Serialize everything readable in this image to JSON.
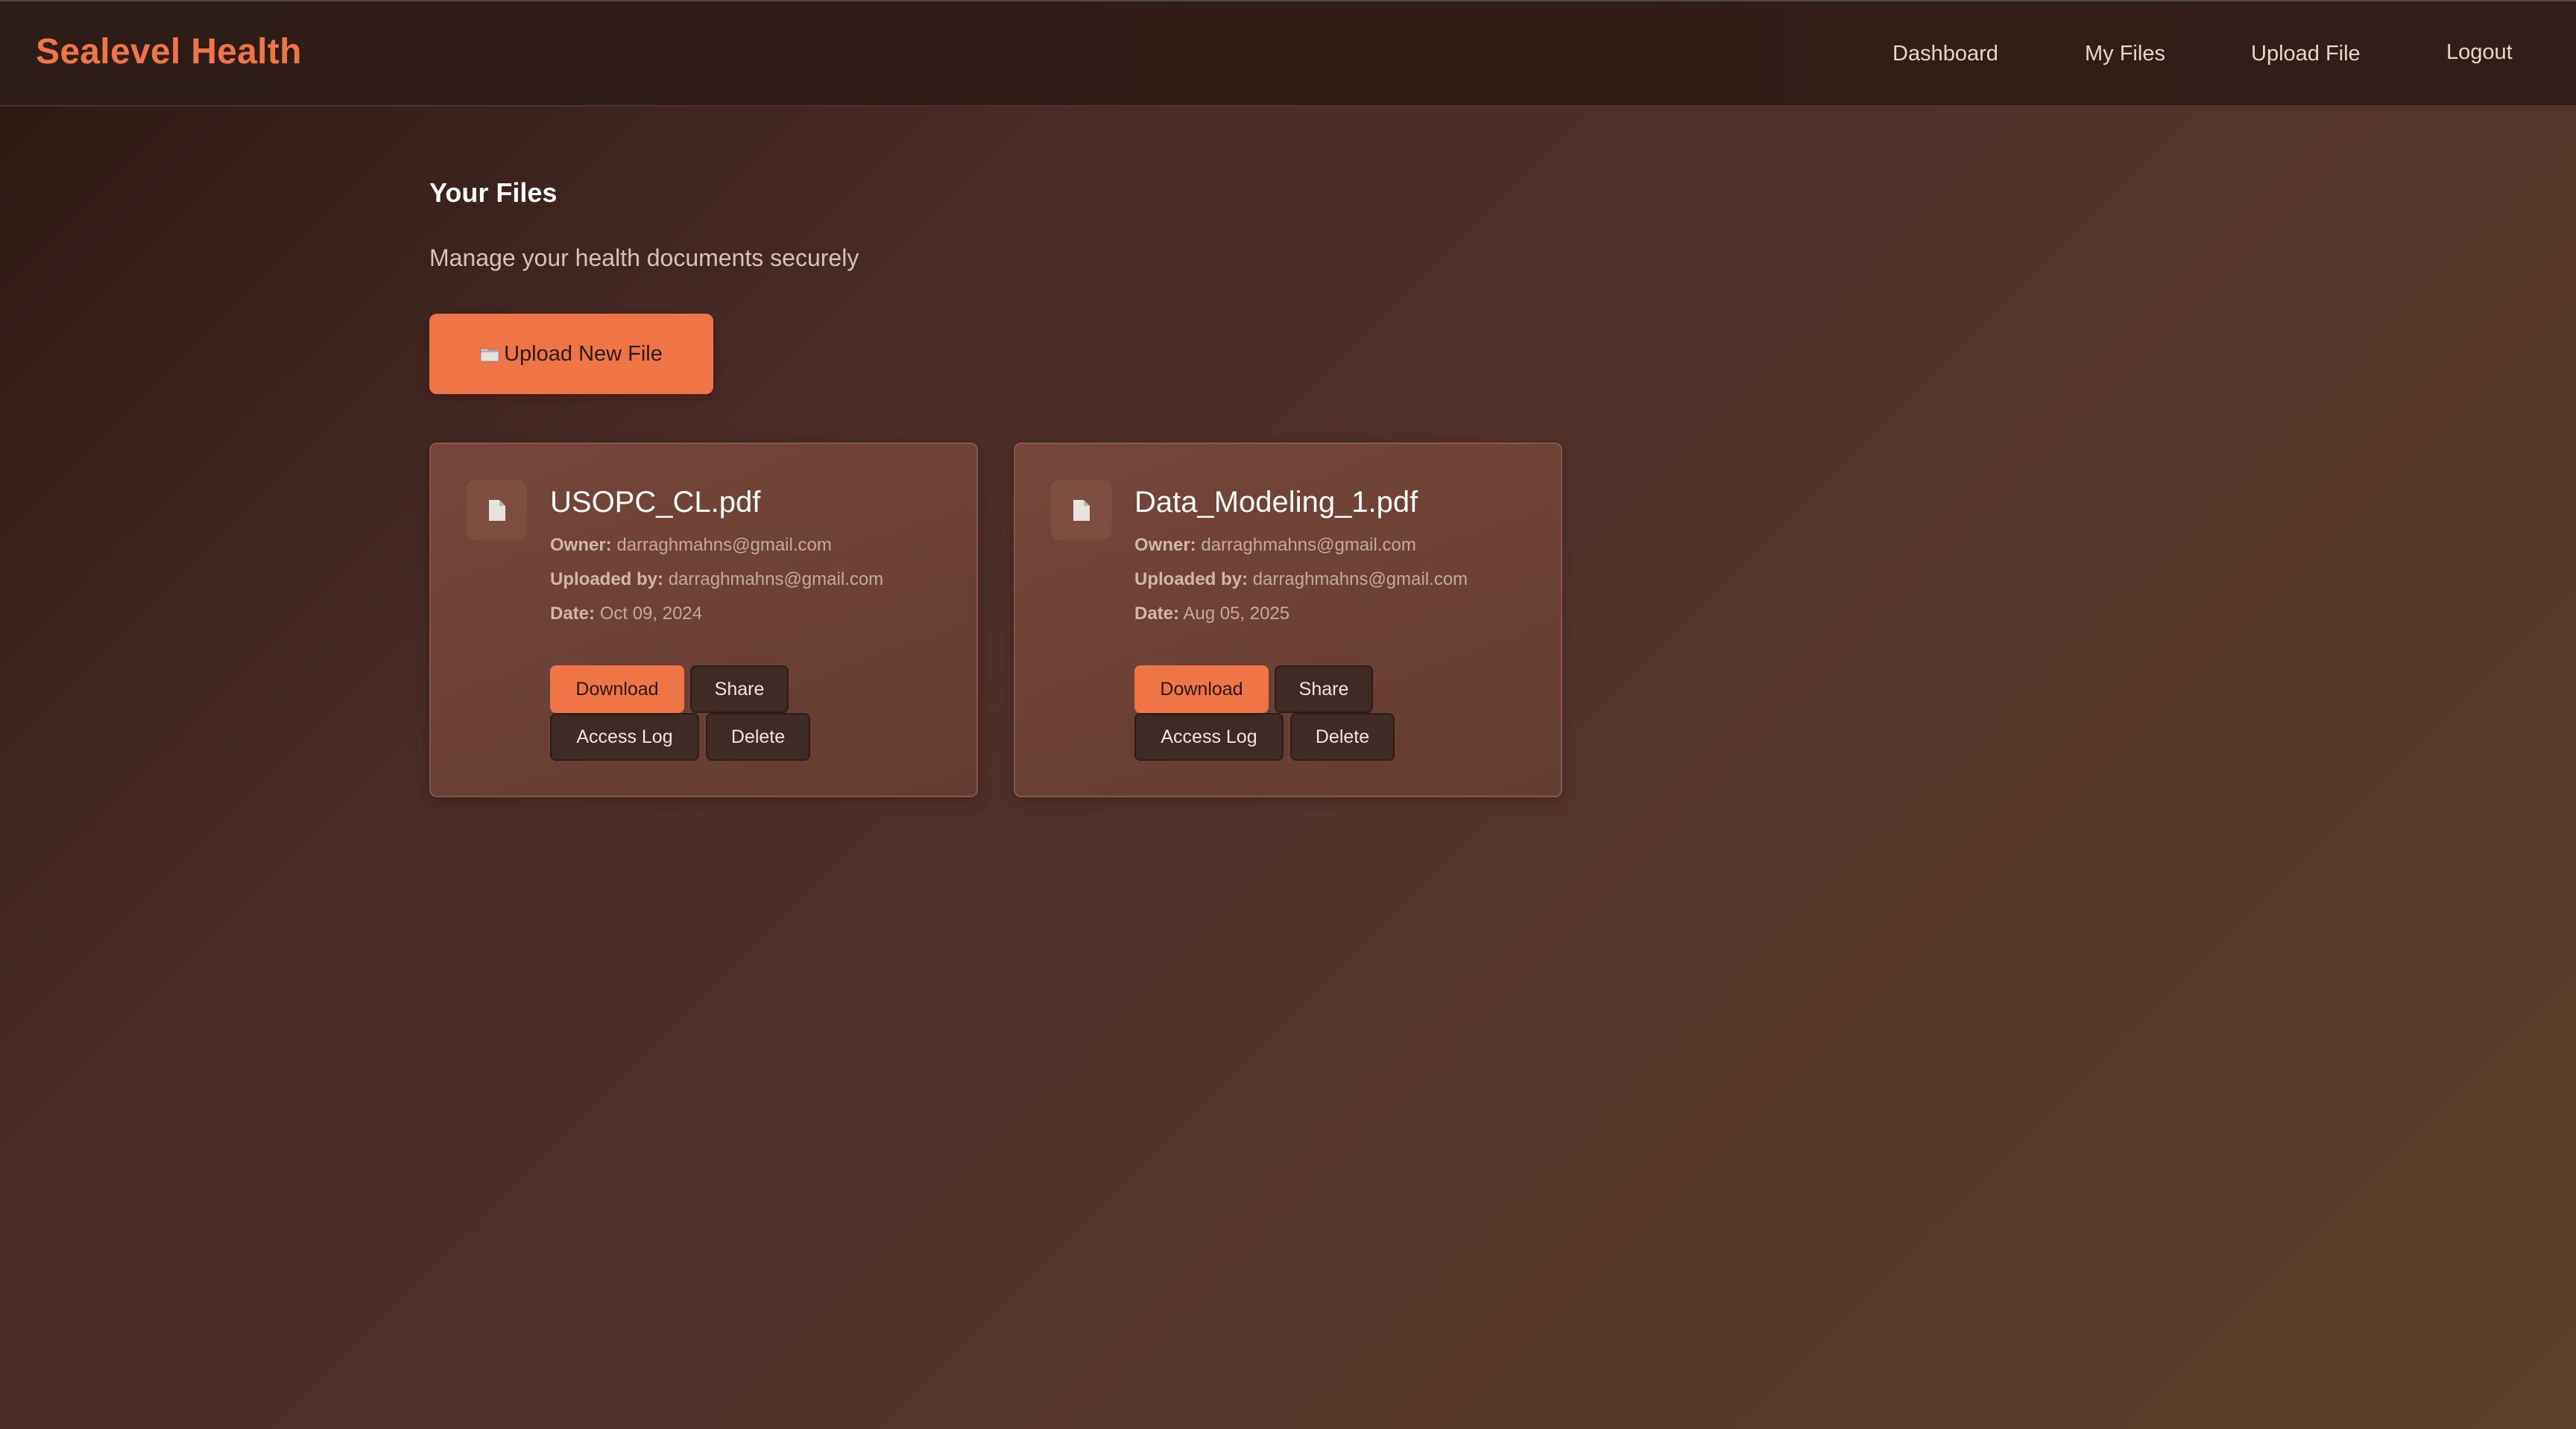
{
  "navbar": {
    "brand": "Sealevel Health",
    "links": [
      "Dashboard",
      "My Files",
      "Upload File",
      "Logout"
    ]
  },
  "page": {
    "title": "Your Files",
    "subtitle": "Manage your health documents securely",
    "upload_button": {
      "icon": "folder-icon",
      "label": "Upload New File"
    }
  },
  "files": [
    {
      "icon": "document-icon",
      "name": "USOPC_CL.pdf",
      "owner_label": "Owner:",
      "owner": "darraghmahns@gmail.com",
      "uploaded_by_label": "Uploaded by:",
      "uploaded_by": "darraghmahns@gmail.com",
      "date_label": "Date:",
      "date": "Oct 09, 2024",
      "actions": [
        "Download",
        "Share",
        "Access Log",
        "Delete"
      ]
    },
    {
      "icon": "document-icon",
      "name": "Data_Modeling_1.pdf",
      "owner_label": "Owner:",
      "owner": "darraghmahns@gmail.com",
      "uploaded_by_label": "Uploaded by:",
      "uploaded_by": "darraghmahns@gmail.com",
      "date_label": "Date:",
      "date": "Aug 05, 2025",
      "actions": [
        "Download",
        "Share",
        "Access Log",
        "Delete"
      ]
    }
  ],
  "colors": {
    "accent": "#ef7546",
    "card_background": "#6f4236",
    "secondary_button": "#3f2a26"
  }
}
